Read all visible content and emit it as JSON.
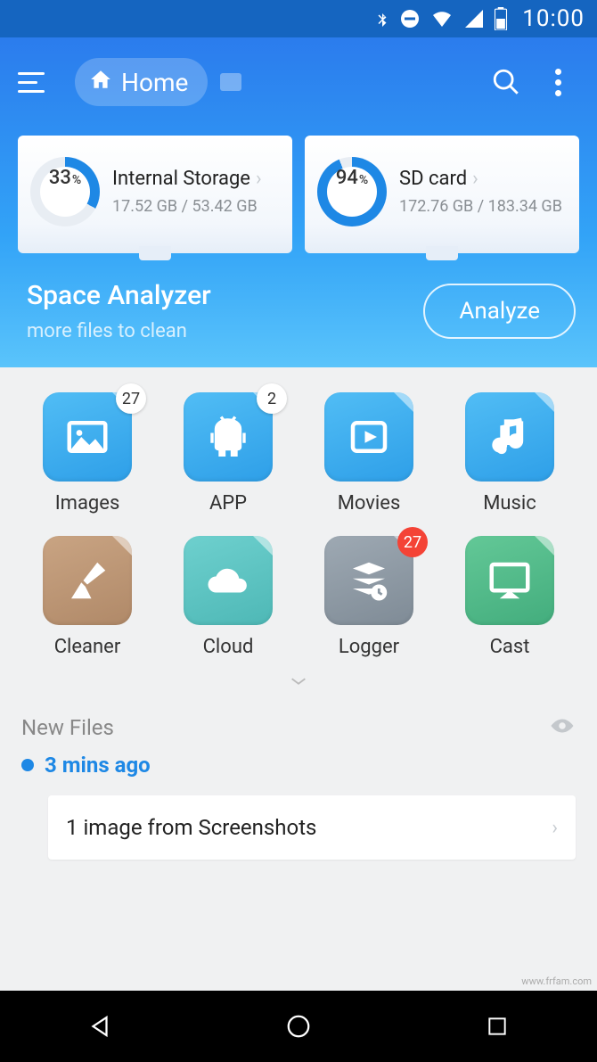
{
  "statusbar": {
    "time": "10:00"
  },
  "appbar": {
    "home_label": "Home"
  },
  "storages": [
    {
      "name": "Internal Storage",
      "percent": 33,
      "used": "17.52 GB",
      "total": "53.42 GB"
    },
    {
      "name": "SD card",
      "percent": 94,
      "used": "172.76 GB",
      "total": "183.34 GB"
    }
  ],
  "analyzer": {
    "title": "Space Analyzer",
    "subtitle": "more files to clean",
    "button": "Analyze"
  },
  "categories": [
    {
      "id": "images",
      "label": "Images",
      "badge": "27",
      "badgeStyle": "white",
      "theme": "blue"
    },
    {
      "id": "app",
      "label": "APP",
      "badge": "2",
      "badgeStyle": "white",
      "theme": "blue"
    },
    {
      "id": "movies",
      "label": "Movies",
      "theme": "blue"
    },
    {
      "id": "music",
      "label": "Music",
      "theme": "blue"
    },
    {
      "id": "cleaner",
      "label": "Cleaner",
      "theme": "brown"
    },
    {
      "id": "cloud",
      "label": "Cloud",
      "theme": "teal"
    },
    {
      "id": "logger",
      "label": "Logger",
      "badge": "27",
      "badgeStyle": "red",
      "theme": "gray"
    },
    {
      "id": "cast",
      "label": "Cast",
      "theme": "green"
    }
  ],
  "newfiles": {
    "header": "New Files",
    "groups": [
      {
        "time_label": "3 mins ago",
        "items": [
          {
            "title": "1 image from Screenshots"
          }
        ]
      }
    ]
  },
  "watermark": "www.frfam.com"
}
